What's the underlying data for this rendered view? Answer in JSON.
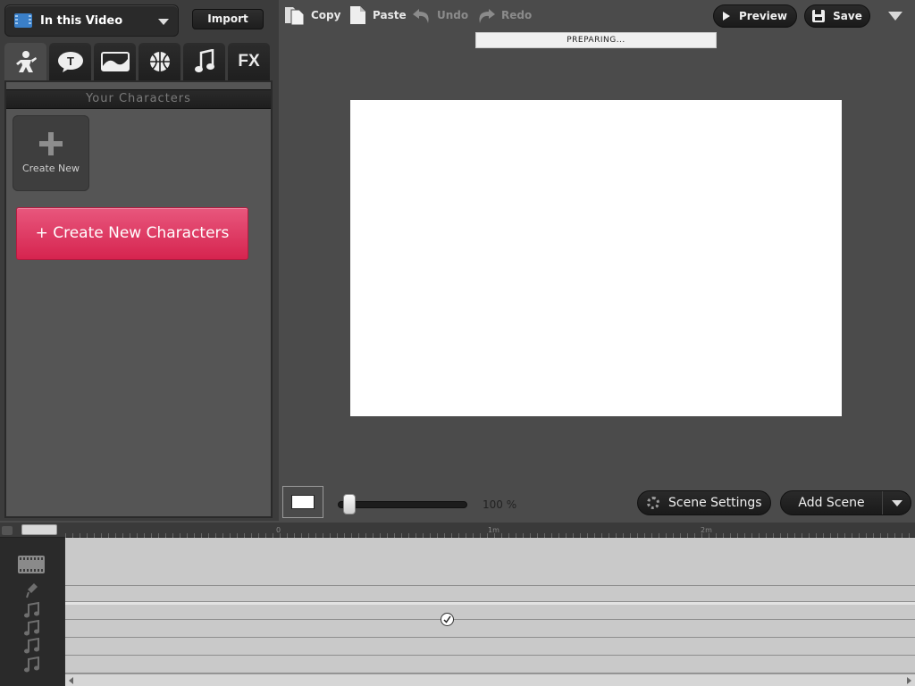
{
  "library": {
    "source_label": "In this Video",
    "import_label": "Import",
    "tabs": [
      {
        "name": "characters",
        "icon": "character-icon"
      },
      {
        "name": "text",
        "icon": "speech-bubble-icon"
      },
      {
        "name": "backgrounds",
        "icon": "landscape-icon"
      },
      {
        "name": "props",
        "icon": "ball-icon"
      },
      {
        "name": "music",
        "icon": "music-note-icon"
      },
      {
        "name": "effects",
        "icon": "fx-icon",
        "text": "FX"
      }
    ],
    "section_title": "Your Characters",
    "create_new_label": "Create New",
    "create_characters_label": "+ Create New Characters"
  },
  "toolbar": {
    "copy_label": "Copy",
    "paste_label": "Paste",
    "undo_label": "Undo",
    "redo_label": "Redo",
    "status_text": "PREPARING...",
    "preview_label": "Preview",
    "save_label": "Save"
  },
  "stage_controls": {
    "zoom_text": "100 %",
    "scene_settings_label": "Scene Settings",
    "add_scene_label": "Add Scene"
  },
  "timeline": {
    "ruler_marks": [
      "0",
      "1m",
      "2m"
    ],
    "track_icons": [
      "film-strip-icon",
      "microphone-icon",
      "music-note-icon",
      "music-note-icon",
      "music-note-icon",
      "music-note-icon"
    ]
  },
  "colors": {
    "background": "#4b4b4b",
    "accent_pink": "#e0365f",
    "stage": "#ffffff"
  }
}
